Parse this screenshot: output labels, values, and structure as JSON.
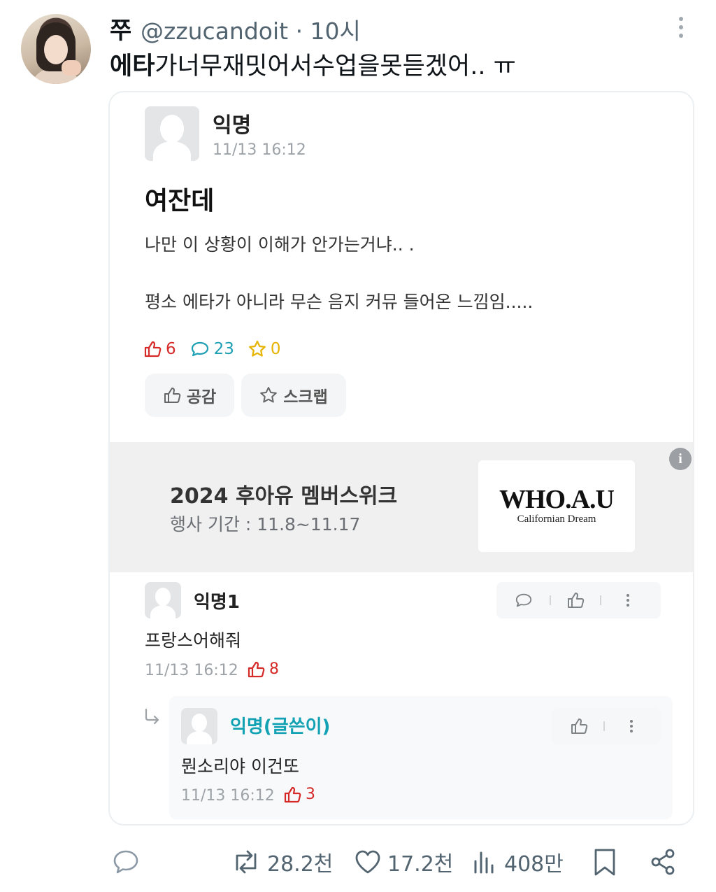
{
  "tweet": {
    "display_name": "쭈",
    "handle_time": "@zzucandoit · 10시",
    "text_bold": "에타",
    "text_rest": "가너무재밋어서수업을못듣겠어.. ㅠ"
  },
  "post": {
    "author": "익명",
    "time": "11/13 16:12",
    "title": "여잔데",
    "body_line1": "나만 이 상황이 이해가 안가는거냐.. .",
    "body_line2": "평소 에타가 아니라 무슨 음지 커뮤 들어온 느낌임.....",
    "likes": "6",
    "comments": "23",
    "scraps": "0",
    "like_button": "공감",
    "scrap_button": "스크랩"
  },
  "ad": {
    "title": "2024 후아유 멤버스위크",
    "period": "행사 기간 : 11.8~11.17",
    "logo_main": "WHO.A.U",
    "logo_sub": "Californian Dream",
    "info_icon": "i"
  },
  "comments": [
    {
      "author": "익명1",
      "body": "프랑스어해줘",
      "time": "11/13 16:12",
      "likes": "8"
    }
  ],
  "reply": {
    "author": "익명(글쓴이)",
    "body": "뭔소리야 이건또",
    "time": "11/13 16:12",
    "likes": "3"
  },
  "tweet_actions": {
    "retweets": "28.2천",
    "likes": "17.2천",
    "views": "408만"
  },
  "colors": {
    "like_red": "#d52a28",
    "comment_teal": "#1ea0b4",
    "scrap_yellow": "#e6b400",
    "writer_teal": "#12a2b4",
    "twitter_gray": "#536471"
  }
}
